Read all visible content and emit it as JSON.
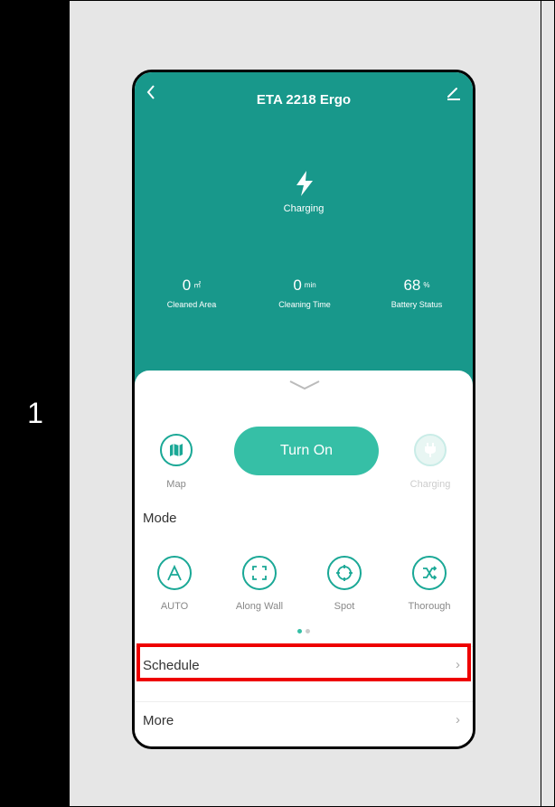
{
  "step": "1",
  "app": {
    "title": "ETA 2218 Ergo",
    "back_icon": "chevron-left-icon",
    "edit_icon": "pencil-icon"
  },
  "status": {
    "label": "Charging",
    "icon": "lightning-bolt-icon"
  },
  "stats": [
    {
      "value": "0",
      "unit": "㎡",
      "label": "Cleaned Area"
    },
    {
      "value": "0",
      "unit": "min",
      "label": "Cleaning Time"
    },
    {
      "value": "68",
      "unit": "%",
      "label": "Battery Status"
    }
  ],
  "controls": {
    "map_label": "Map",
    "turn_on_label": "Turn On",
    "charging_label": "Charging"
  },
  "mode": {
    "heading": "Mode",
    "items": [
      {
        "label": "AUTO",
        "icon": "letter-a-icon"
      },
      {
        "label": "Along Wall",
        "icon": "corners-frame-icon"
      },
      {
        "label": "Spot",
        "icon": "crosshair-icon"
      },
      {
        "label": "Thorough",
        "icon": "shuffle-icon"
      }
    ],
    "page_index": 1,
    "page_count": 2
  },
  "rows": {
    "schedule": "Schedule",
    "more": "More",
    "arrow": "›"
  },
  "colors": {
    "header": "#18988b",
    "accent": "#36bfa6",
    "highlight": "#ee0000"
  }
}
